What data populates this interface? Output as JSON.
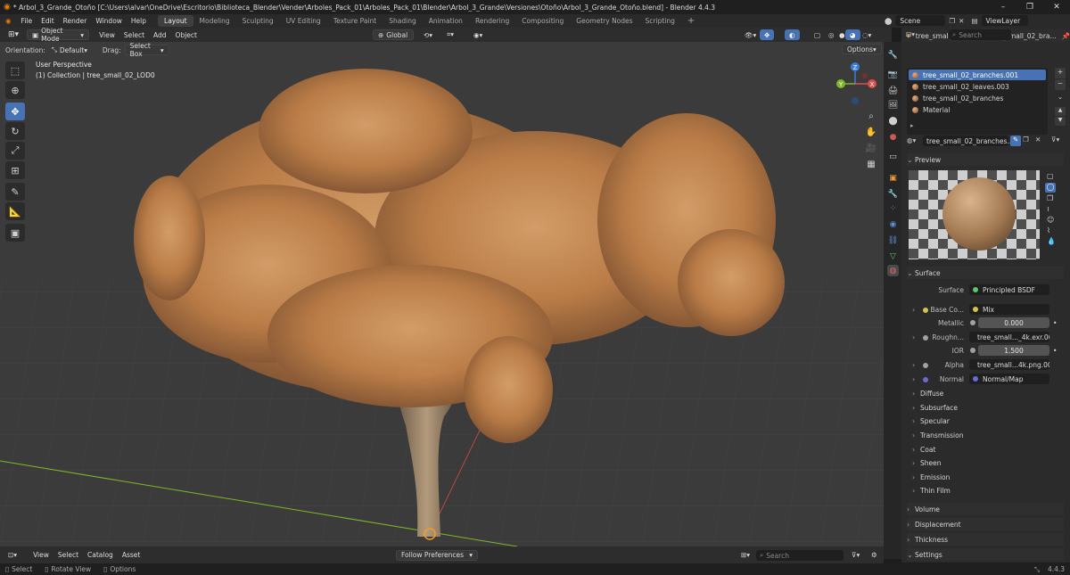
{
  "title": "* Arbol_3_Grande_Otoño [C:\\Users\\alvar\\OneDrive\\Escritorio\\Biblioteca_Blender\\Vender\\Arboles_Pack_01\\Arboles_Pack_01\\Blender\\Arbol_3_Grande\\Versiones\\Otoño\\Arbol_3_Grande_Otoño.blend] - Blender 4.4.3",
  "menu": [
    "File",
    "Edit",
    "Render",
    "Window",
    "Help"
  ],
  "workspaces": [
    "Layout",
    "Modeling",
    "Sculpting",
    "UV Editing",
    "Texture Paint",
    "Shading",
    "Animation",
    "Rendering",
    "Compositing",
    "Geometry Nodes",
    "Scripting"
  ],
  "active_workspace": "Layout",
  "scene": "Scene",
  "view_layer": "ViewLayer",
  "viewport_header": {
    "mode": "Object Mode",
    "menus": [
      "View",
      "Select",
      "Add",
      "Object"
    ],
    "transform": "Global",
    "options": "Options"
  },
  "tool_header": {
    "orientation_label": "Orientation:",
    "orientation_value": "Default",
    "drag_label": "Drag:",
    "drag_value": "Select Box"
  },
  "overlay_text": {
    "perspective": "User Perspective",
    "collection": "(1) Collection | tree_small_02_LOD0"
  },
  "gizmo": {
    "x": "X",
    "y": "Y",
    "z": "Z"
  },
  "properties": {
    "object_name": "tree_small_...",
    "material_name": "tree_small_02_bra...",
    "search_placeholder": "Search",
    "materials": [
      "tree_small_02_branches.001",
      "tree_small_02_leaves.003",
      "tree_small_02_branches",
      "Material"
    ],
    "selected_material": "tree_small_02_branches...",
    "preview_label": "Preview",
    "surface_label": "Surface",
    "surface_value": "Principled BSDF",
    "base_color_label": "Base Co...",
    "base_color_value": "Mix",
    "metallic_label": "Metallic",
    "metallic_value": "0.000",
    "roughness_label": "Roughn...",
    "roughness_value": "tree_small..._4k.exr.001",
    "ior_label": "IOR",
    "ior_value": "1.500",
    "alpha_label": "Alpha",
    "alpha_value": "tree_small...4k.png.001",
    "normal_label": "Normal",
    "normal_value": "Normal/Map",
    "subsections": [
      "Diffuse",
      "Subsurface",
      "Specular",
      "Transmission",
      "Coat",
      "Sheen",
      "Emission",
      "Thin Film"
    ],
    "sections": [
      "Volume",
      "Displacement",
      "Thickness",
      "Settings"
    ]
  },
  "bottom_bar": {
    "menus": [
      "View",
      "Select",
      "Catalog",
      "Asset"
    ],
    "dropdown": "Follow Preferences",
    "search_placeholder": "Search"
  },
  "status_bar": {
    "select": "Select",
    "rotate": "Rotate View",
    "options": "Options",
    "version": "4.4.3"
  },
  "colors": {
    "accent": "#4772b3",
    "foliage": "#c98a52",
    "trunk": "#9a8266",
    "x_axis": "#e44b4b",
    "y_axis": "#7eb82a",
    "z_axis": "#3a7ddb"
  }
}
